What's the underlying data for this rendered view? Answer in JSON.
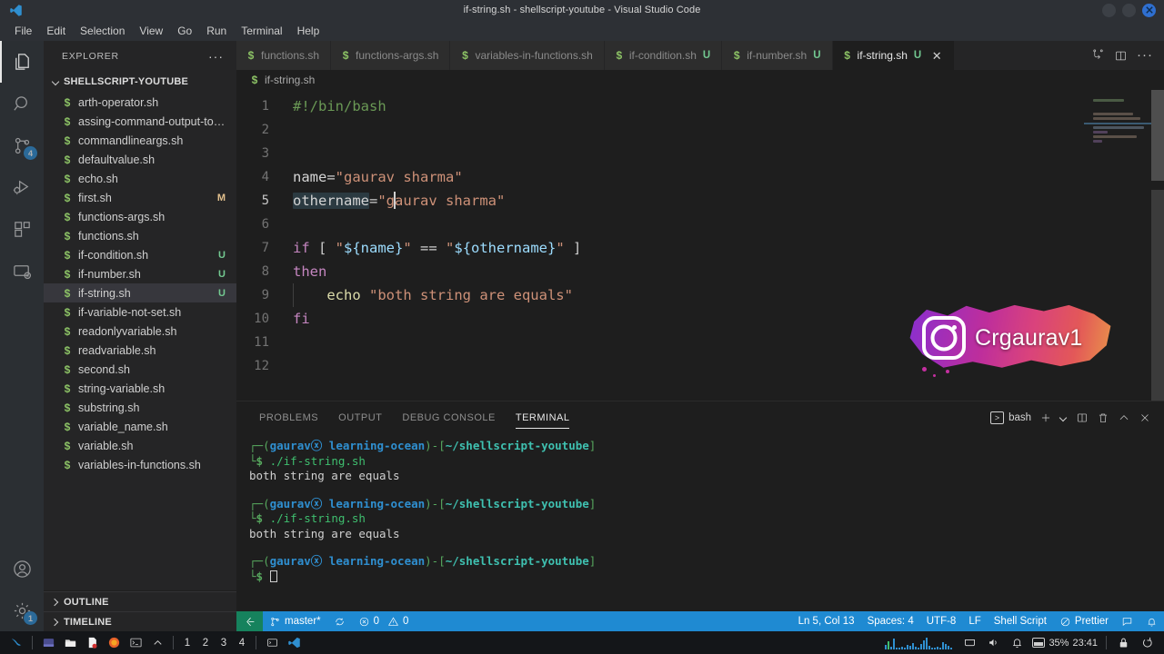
{
  "titlebar": {
    "title": "if-string.sh - shellscript-youtube - Visual Studio Code",
    "logo_icon": "vscode-logo-icon",
    "minimize_icon": "minimize-icon",
    "maximize_icon": "maximize-icon",
    "close_icon": "close-icon"
  },
  "menubar": {
    "items": [
      {
        "label": "File"
      },
      {
        "label": "Edit"
      },
      {
        "label": "Selection"
      },
      {
        "label": "View"
      },
      {
        "label": "Go"
      },
      {
        "label": "Run"
      },
      {
        "label": "Terminal"
      },
      {
        "label": "Help"
      }
    ]
  },
  "activitybar": {
    "items": [
      {
        "name": "explorer",
        "icon": "files-icon",
        "active": true,
        "badge": ""
      },
      {
        "name": "search",
        "icon": "search-icon",
        "active": false,
        "badge": ""
      },
      {
        "name": "source-control",
        "icon": "source-control-icon",
        "active": false,
        "badge": "4"
      },
      {
        "name": "run-and-debug",
        "icon": "run-debug-icon",
        "active": false,
        "badge": ""
      },
      {
        "name": "extensions",
        "icon": "extensions-icon",
        "active": false,
        "badge": ""
      },
      {
        "name": "remote-explorer",
        "icon": "remote-explorer-icon",
        "active": false,
        "badge": ""
      }
    ],
    "bottom": [
      {
        "name": "accounts",
        "icon": "account-icon",
        "badge": ""
      },
      {
        "name": "settings",
        "icon": "gear-icon",
        "badge": "1"
      }
    ]
  },
  "sidebar": {
    "title": "EXPLORER",
    "more_actions": "···",
    "folder": "SHELLSCRIPT-YOUTUBE",
    "files": [
      {
        "name": "arth-operator.sh",
        "badge": ""
      },
      {
        "name": "assing-command-output-to-...",
        "badge": ""
      },
      {
        "name": "commandlineargs.sh",
        "badge": ""
      },
      {
        "name": "defaultvalue.sh",
        "badge": ""
      },
      {
        "name": "echo.sh",
        "badge": ""
      },
      {
        "name": "first.sh",
        "badge": "M"
      },
      {
        "name": "functions-args.sh",
        "badge": ""
      },
      {
        "name": "functions.sh",
        "badge": ""
      },
      {
        "name": "if-condition.sh",
        "badge": "U"
      },
      {
        "name": "if-number.sh",
        "badge": "U"
      },
      {
        "name": "if-string.sh",
        "badge": "U",
        "selected": true
      },
      {
        "name": "if-variable-not-set.sh",
        "badge": ""
      },
      {
        "name": "readonlyvariable.sh",
        "badge": ""
      },
      {
        "name": "readvariable.sh",
        "badge": ""
      },
      {
        "name": "second.sh",
        "badge": ""
      },
      {
        "name": "string-variable.sh",
        "badge": ""
      },
      {
        "name": "substring.sh",
        "badge": ""
      },
      {
        "name": "variable_name.sh",
        "badge": ""
      },
      {
        "name": "variable.sh",
        "badge": ""
      },
      {
        "name": "variables-in-functions.sh",
        "badge": ""
      }
    ],
    "sections": [
      {
        "label": "OUTLINE"
      },
      {
        "label": "TIMELINE"
      }
    ]
  },
  "editor": {
    "tabs": [
      {
        "label": "functions.sh",
        "badge": "",
        "active": false
      },
      {
        "label": "functions-args.sh",
        "badge": "",
        "active": false
      },
      {
        "label": "variables-in-functions.sh",
        "badge": "",
        "active": false
      },
      {
        "label": "if-condition.sh",
        "badge": "U",
        "active": false
      },
      {
        "label": "if-number.sh",
        "badge": "U",
        "active": false
      },
      {
        "label": "if-string.sh",
        "badge": "U",
        "active": true,
        "close_icon": "close-icon"
      }
    ],
    "tab_actions": [
      {
        "name": "split-in-group",
        "icon": "split-in-group-icon"
      },
      {
        "name": "split-editor",
        "icon": "split-editor-icon"
      },
      {
        "name": "more-actions",
        "icon": "more-actions-icon",
        "label": "···"
      }
    ],
    "breadcrumb": "if-string.sh",
    "lines": [
      {
        "n": "1",
        "text": "#!/bin/bash"
      },
      {
        "n": "2",
        "text": ""
      },
      {
        "n": "3",
        "text": ""
      },
      {
        "n": "4",
        "text": "name=\"gaurav sharma\""
      },
      {
        "n": "5",
        "text": "othername=\"gaurav sharma\""
      },
      {
        "n": "6",
        "text": ""
      },
      {
        "n": "7",
        "text": "if [ \"${name}\" == \"${othername}\" ]"
      },
      {
        "n": "8",
        "text": "then"
      },
      {
        "n": "9",
        "text": "    echo \"both string are equals\""
      },
      {
        "n": "10",
        "text": "fi"
      },
      {
        "n": "11",
        "text": ""
      },
      {
        "n": "12",
        "text": ""
      }
    ]
  },
  "watermark": {
    "icon": "instagram-icon",
    "handle": "Crgaurav1"
  },
  "panel": {
    "tabs": [
      {
        "label": "PROBLEMS",
        "active": false
      },
      {
        "label": "OUTPUT",
        "active": false
      },
      {
        "label": "DEBUG CONSOLE",
        "active": false
      },
      {
        "label": "TERMINAL",
        "active": true
      }
    ],
    "shell_label": "bash",
    "actions": [
      {
        "name": "new-terminal",
        "icon": "plus-icon"
      },
      {
        "name": "terminal-dropdown",
        "icon": "chevron-down-icon"
      },
      {
        "name": "split-terminal",
        "icon": "split-terminal-icon"
      },
      {
        "name": "kill-terminal",
        "icon": "trash-icon"
      },
      {
        "name": "maximize-panel",
        "icon": "chevron-up-icon"
      },
      {
        "name": "close-panel",
        "icon": "close-icon"
      }
    ],
    "terminal": {
      "user": "gaurav",
      "at": "ⓧ",
      "host": "learning-ocean",
      "path": "~/shellscript-youtube",
      "blocks": [
        {
          "command": "./if-string.sh",
          "output": "both string are equals"
        },
        {
          "command": "./if-string.sh",
          "output": "both string are equals"
        },
        {
          "command": "",
          "output": ""
        }
      ]
    }
  },
  "statusbar": {
    "remote_icon": "remote-window-icon",
    "branch_icon": "source-control-icon",
    "branch": "master*",
    "sync_icon": "sync-icon",
    "errors_icon": "error-icon",
    "errors": "0",
    "warnings_icon": "warning-icon",
    "warnings": "0",
    "position": "Ln 5, Col 13",
    "spaces": "Spaces: 4",
    "encoding": "UTF-8",
    "eol": "LF",
    "language": "Shell Script",
    "formatter_icon": "prohibited-icon",
    "formatter": "Prettier",
    "feedback_icon": "feedback-icon",
    "bell_icon": "bell-icon"
  },
  "taskbar": {
    "start_icon": "kali-dragon-icon",
    "apps": [
      {
        "name": "terminal-app",
        "icon": "terminal-icon"
      },
      {
        "name": "files-app",
        "icon": "folder-icon"
      },
      {
        "name": "text-editor-app",
        "icon": "document-icon"
      },
      {
        "name": "firefox-app",
        "icon": "firefox-icon"
      },
      {
        "name": "console-app",
        "icon": "console-icon"
      },
      {
        "name": "show-apps",
        "icon": "chevron-up-icon"
      }
    ],
    "workspaces": [
      "1",
      "2",
      "3",
      "4"
    ],
    "windows": [
      {
        "name": "window-terminal",
        "icon": "window-icon"
      },
      {
        "name": "window-vscode",
        "icon": "vscode-logo-icon"
      }
    ],
    "tray": {
      "network_icon": "network-graph-icon",
      "display_icon": "display-icon",
      "volume_icon": "volume-icon",
      "bell_icon": "bell-icon",
      "battery_icon": "battery-icon",
      "battery": "35%",
      "clock": "23:41",
      "lock_icon": "lock-icon",
      "power_icon": "power-icon"
    }
  },
  "colors": {
    "accent": "#1f8ad2",
    "remote_green": "#16825d",
    "file_icon_green": "#8cc265",
    "untracked": "#73c991",
    "modified": "#e2c08d"
  }
}
